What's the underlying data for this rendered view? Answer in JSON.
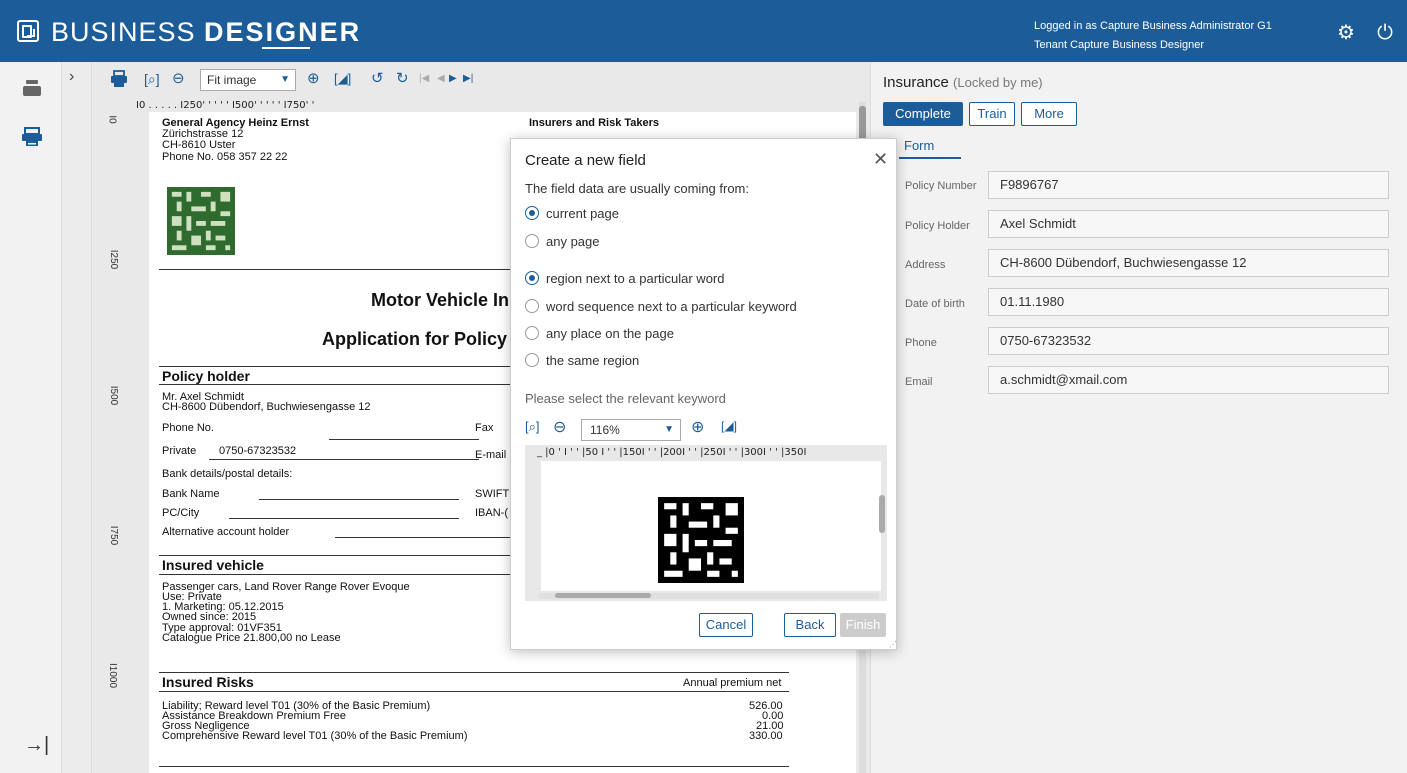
{
  "header": {
    "brand_part1": "BUSINESS ",
    "brand_part2": "DESIGNER",
    "login_line1": "Logged in as Capture Business Administrator G1",
    "login_line2": "Tenant Capture Business Designer",
    "settings_icon": "gear-icon",
    "logout_icon": "power-icon"
  },
  "viewer": {
    "zoom_value": "Fit image",
    "ruler_h": "I0 .    .    .    .    .   I250'  '    '    '    '   I500'  '    '    '    '   I750'  '",
    "ruler_v": [
      "I0",
      "I250",
      "I500",
      "I750",
      "I1000"
    ]
  },
  "document": {
    "agency_name": "General Agency Heinz Ernst",
    "agency_street": "Zürichstrasse 12",
    "agency_city": "CH-8610 Uster",
    "agency_phone": "Phone No. 058 357 22 22",
    "insurers": "Insurers and Risk Takers",
    "title1": "Motor Vehicle In",
    "title2": "Application for Policy",
    "policy_holder_heading": "Policy holder",
    "holder_name": "Mr.  Axel Schmidt",
    "holder_address": "CH-8600 Dübendorf, Buchwiesengasse 12",
    "phone_label": "Phone No.",
    "fax_label": "Fax",
    "private_label": "Private",
    "private_value": "0750-67323532",
    "email_label": "E-mail",
    "bank_details": "Bank details/postal details:",
    "bank_name": "Bank Name",
    "swift": "SWIFT",
    "pc_city": "PC/City",
    "iban": "IBAN-(",
    "alt_holder": "Alternative account holder",
    "insured_vehicle_heading": "Insured vehicle",
    "vehicle_lines": [
      "Passenger cars, Land Rover Range Rover Evoque",
      "Use: Private",
      "1. Marketing: 05.12.2015",
      "Owned since: 2015",
      "Type approval: 01VF351",
      "Catalogue Price 21.800,00  no Lease"
    ],
    "insured_risks_heading": "Insured Risks",
    "annual_premium_label": "Annual premium net",
    "risks": [
      {
        "name": "Liability; Reward level T01 (30% of the Basic Premium)",
        "value": "526.00"
      },
      {
        "name": "Assistance Breakdown Premium Free",
        "value": "0.00"
      },
      {
        "name": "Gross Negligence",
        "value": "21.00"
      },
      {
        "name": "Comprehensive Reward level  T01 (30% of the Basic Premium)",
        "value": "330.00"
      }
    ]
  },
  "modal": {
    "title": "Create a new field",
    "source_prompt": "The field data are usually coming from:",
    "source_options": [
      {
        "label": "current page",
        "selected": true
      },
      {
        "label": "any page",
        "selected": false
      }
    ],
    "location_options": [
      {
        "label": "region next to a particular word",
        "selected": true
      },
      {
        "label": "word sequence next to a particular keyword",
        "selected": false
      },
      {
        "label": "any place on the page",
        "selected": false
      },
      {
        "label": "the same region",
        "selected": false
      }
    ],
    "keyword_hint": "Please select the relevant keyword",
    "zoom_value": "116%",
    "ruler": "_ |0 ' I ' ' |50  I ' ' |150I ' ' |200I ' ' |250I ' ' |300I ' ' |350I",
    "cancel_label": "Cancel",
    "back_label": "Back",
    "finish_label": "Finish"
  },
  "panel": {
    "title": "Insurance",
    "locked_note": "(Locked by me)",
    "complete_label": "Complete",
    "train_label": "Train",
    "more_label": "More",
    "form_tab": "Form",
    "fields": [
      {
        "label": "Policy Number",
        "value": "F9896767"
      },
      {
        "label": "Policy Holder",
        "value": "Axel Schmidt"
      },
      {
        "label": "Address",
        "value": "CH-8600 Dübendorf, Buchwiesengasse 12"
      },
      {
        "label": "Date of birth",
        "value": "01.11.1980"
      },
      {
        "label": "Phone",
        "value": "0750-67323532"
      },
      {
        "label": "Email",
        "value": "a.schmidt@xmail.com"
      }
    ]
  },
  "colors": {
    "brand": "#1c5d99",
    "disabled": "#cccccc"
  }
}
